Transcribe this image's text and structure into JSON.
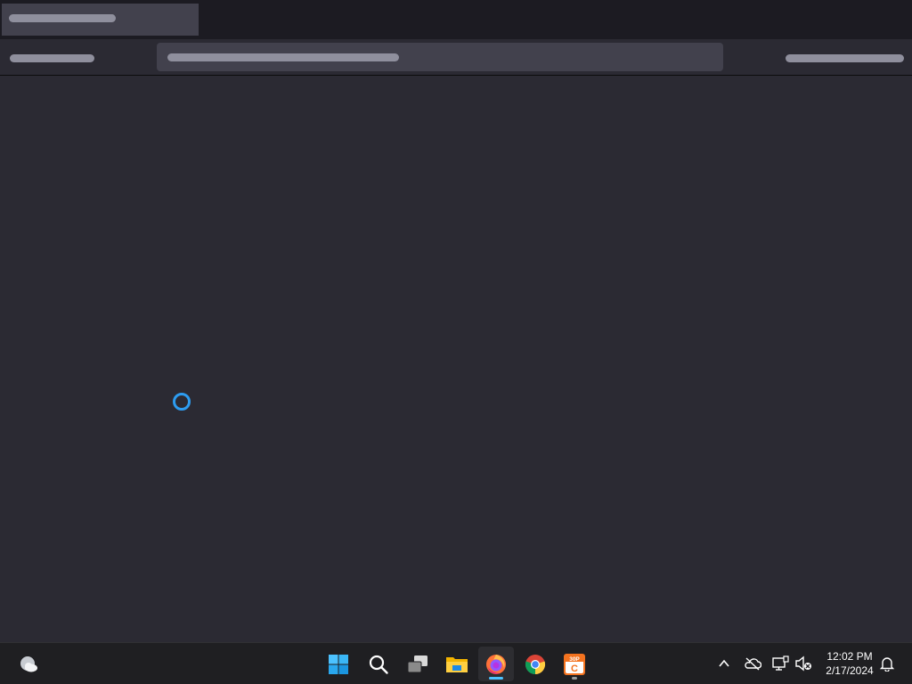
{
  "window": {
    "state": "loading",
    "browser": "Firefox"
  },
  "taskbar": {
    "apps": [
      {
        "name": "Start",
        "icon": "windows-start-icon",
        "active": false
      },
      {
        "name": "Search",
        "icon": "search-icon",
        "active": false
      },
      {
        "name": "Task View",
        "icon": "task-view-icon",
        "active": false
      },
      {
        "name": "File Explorer",
        "icon": "file-explorer-icon",
        "active": false
      },
      {
        "name": "Firefox",
        "icon": "firefox-icon",
        "active": true
      },
      {
        "name": "Chrome",
        "icon": "chrome-icon",
        "active": false
      },
      {
        "name": "30P",
        "icon": "calendar-app-icon",
        "active": false,
        "badge": "30P",
        "letter": "C"
      }
    ],
    "tray": {
      "time": "12:02 PM",
      "date": "2/17/2024",
      "icons": [
        "chevron-up-icon",
        "onedrive-offline-icon",
        "network-icon",
        "volume-muted-icon",
        "notification-bell-icon"
      ]
    }
  },
  "colors": {
    "accent_blue": "#2d9cf0",
    "active_indicator": "#4cc2ff",
    "background": "#2b2a33",
    "tabstrip": "#1c1b22"
  }
}
